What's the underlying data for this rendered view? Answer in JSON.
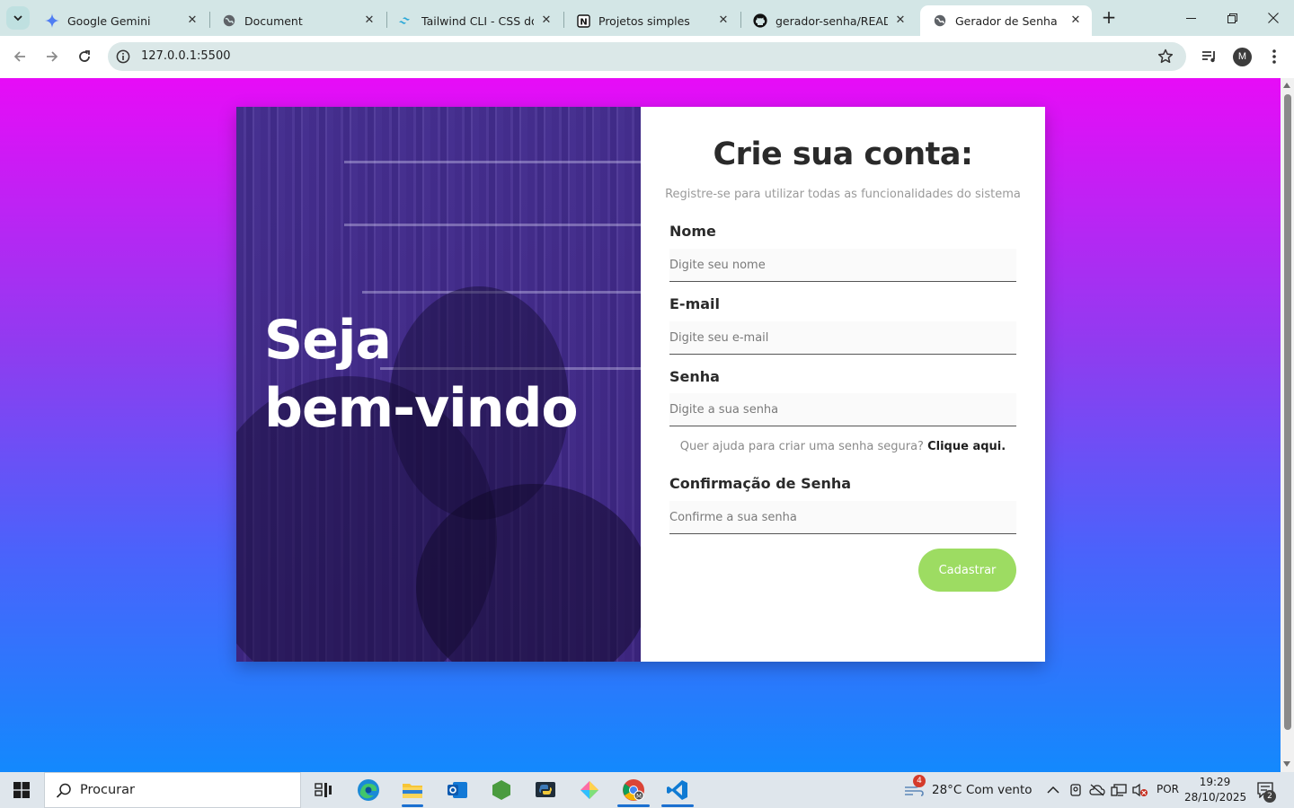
{
  "browser": {
    "tabs": [
      {
        "title": "Google Gemini",
        "icon": "gemini-icon",
        "active": false
      },
      {
        "title": "Document",
        "icon": "globe-icon",
        "active": false
      },
      {
        "title": "Tailwind CLI - CSS do Ta",
        "icon": "tailwind-icon",
        "active": false
      },
      {
        "title": "Projetos simples",
        "icon": "notion-icon",
        "active": false
      },
      {
        "title": "gerador-senha/READM",
        "icon": "github-icon",
        "active": false
      },
      {
        "title": "Gerador de Senha",
        "icon": "globe-icon",
        "active": true
      }
    ],
    "new_tab": "+",
    "url": "127.0.0.1:5500",
    "profile_initial": "M",
    "colors": {
      "tabstrip": "#d3e6e6",
      "omnibox": "#dbe8e8"
    }
  },
  "page": {
    "welcome": {
      "line1": "Seja",
      "line2": "bem-vindo"
    },
    "form": {
      "title": "Crie sua conta:",
      "subtitle": "Registre-se para utilizar todas as funcionalidades do sistema",
      "fields": [
        {
          "label": "Nome",
          "placeholder": "Digite seu nome"
        },
        {
          "label": "E-mail",
          "placeholder": "Digite seu e-mail"
        },
        {
          "label": "Senha",
          "placeholder": "Digite a sua senha"
        },
        {
          "label": "Confirmação de Senha",
          "placeholder": "Confirme a sua senha"
        }
      ],
      "help_text": "Quer ajuda para criar uma senha segura?",
      "help_link": "Clique aqui.",
      "submit_label": "Cadastrar"
    },
    "colors": {
      "gradient_top": "#e70cf7",
      "gradient_bottom": "#1389fd",
      "overlay": "#462d96",
      "submit": "#9ddc62"
    }
  },
  "taskbar": {
    "search_placeholder": "Procurar",
    "apps": [
      "task-view-icon",
      "edge-icon",
      "file-explorer-icon",
      "outlook-icon",
      "nodejs-icon",
      "python-icon",
      "pycharm-icon",
      "chrome-icon",
      "vscode-icon"
    ],
    "weather": {
      "temp": "28°C",
      "desc": "Com vento",
      "badge": "4"
    },
    "language": "POR",
    "time": "19:29",
    "date": "28/10/2025",
    "notification_count": "2"
  }
}
